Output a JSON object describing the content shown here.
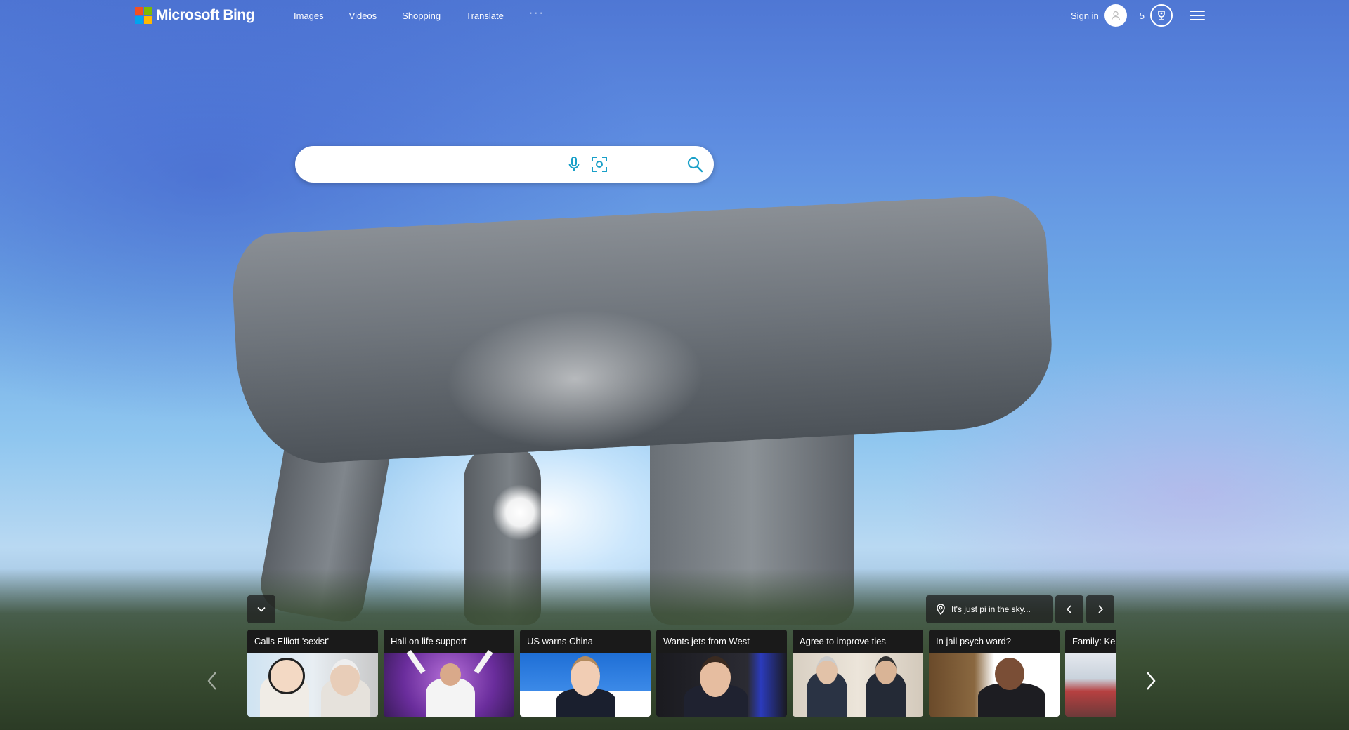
{
  "header": {
    "logo_text": "Microsoft Bing",
    "logo_colors": [
      "#f25022",
      "#7fba00",
      "#00a4ef",
      "#ffb900"
    ],
    "nav": [
      "Images",
      "Videos",
      "Shopping",
      "Translate"
    ],
    "more_label": "···",
    "signin_label": "Sign in",
    "rewards_points": "5"
  },
  "search": {
    "placeholder": "",
    "accent_color": "#1aa0c8"
  },
  "location": {
    "label": "It's just pi in the sky..."
  },
  "news": [
    {
      "title": "Calls Elliott 'sexist'"
    },
    {
      "title": "Hall on life support"
    },
    {
      "title": "US warns China"
    },
    {
      "title": "Wants jets from West"
    },
    {
      "title": "Agree to improve ties"
    },
    {
      "title": "In jail psych ward?"
    },
    {
      "title": "Family: Ke"
    }
  ]
}
